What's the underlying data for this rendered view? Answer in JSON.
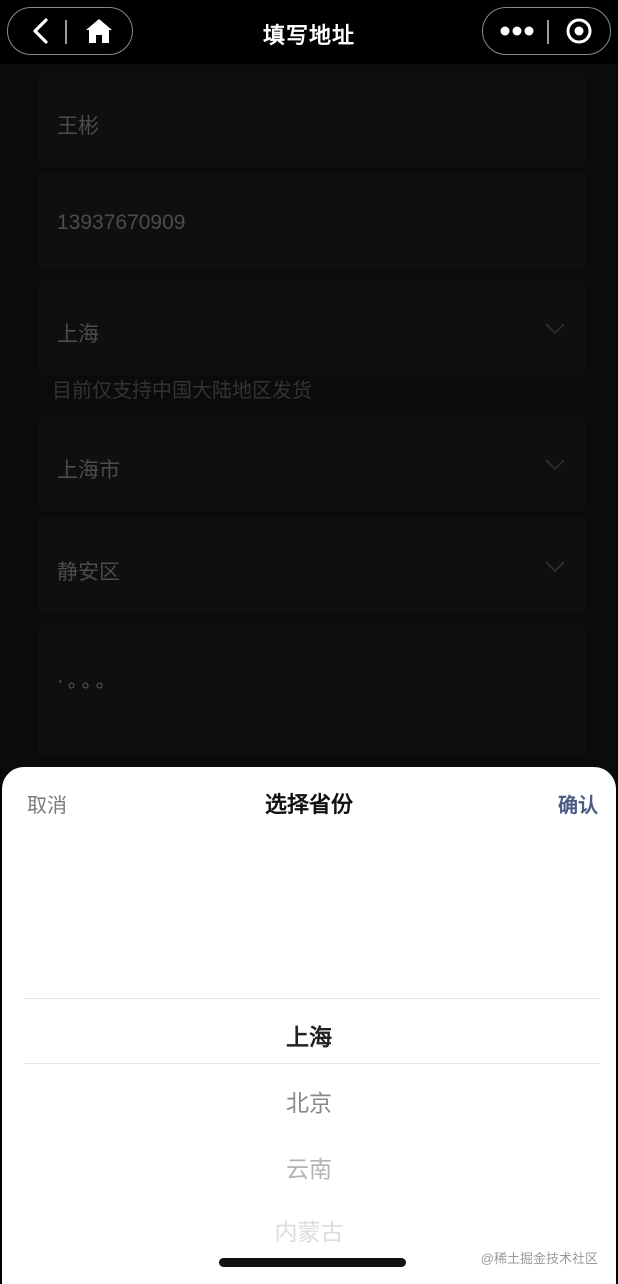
{
  "nav": {
    "title": "填写地址",
    "back_icon": "chevron-left-icon",
    "home_icon": "home-icon",
    "more_icon": "more-dots-icon",
    "close_icon": "target-close-icon"
  },
  "form": {
    "name": "王彬",
    "phone": "13937670909",
    "province": "上海",
    "province_hint": "目前仅支持中国大陆地区发货",
    "city": "上海市",
    "district": "静安区",
    "address_placeholder": "·。。。"
  },
  "picker": {
    "cancel_label": "取消",
    "title": "选择省份",
    "confirm_label": "确认",
    "options": [
      "上海",
      "北京",
      "云南",
      "内蒙古"
    ],
    "selected_index": 0
  },
  "watermark": "@稀土掘金技术社区",
  "colors": {
    "accent": "#4a5b86",
    "sheet_bg": "#ffffff",
    "overlay": "#000000"
  }
}
